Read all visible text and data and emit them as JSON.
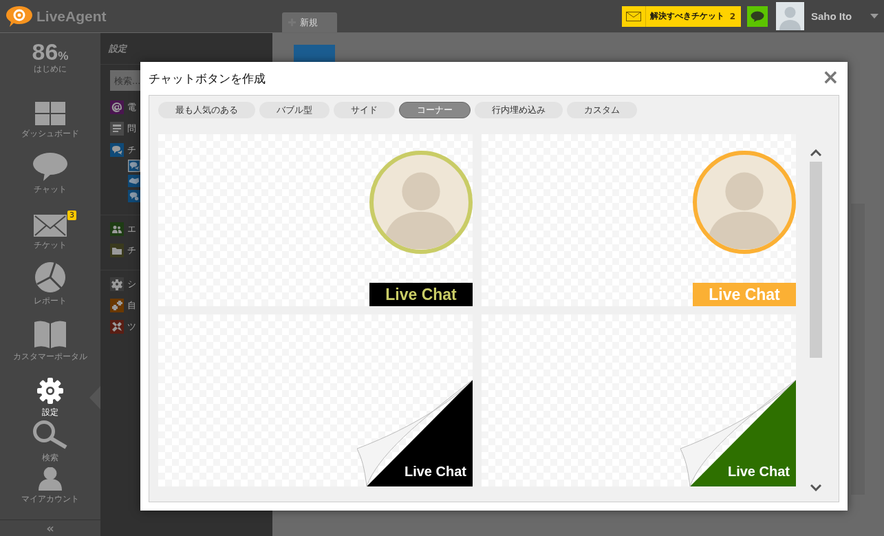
{
  "app": {
    "name": "LiveAgent"
  },
  "new_tab": {
    "label": "新規"
  },
  "ticket_button": {
    "label": "解決すべきチケット",
    "count": "2"
  },
  "user": {
    "name": "Saho Ito"
  },
  "nav": {
    "progress": {
      "value": "86",
      "unit": "%",
      "label": "はじめに"
    },
    "items": [
      {
        "kind": "dashboard",
        "label": "ダッシュボード",
        "selected": false
      },
      {
        "kind": "chat",
        "label": "チャット",
        "selected": false
      },
      {
        "kind": "tickets",
        "label": "チケット",
        "selected": false,
        "badge": "3"
      },
      {
        "kind": "reports",
        "label": "レポート",
        "selected": false
      },
      {
        "kind": "portal",
        "label": "カスタマーポータル",
        "selected": false
      },
      {
        "kind": "settings",
        "label": "設定",
        "selected": true
      },
      {
        "kind": "search",
        "label": "検索",
        "selected": false
      },
      {
        "kind": "account",
        "label": "マイアカウント",
        "selected": false
      }
    ],
    "collapse": "«"
  },
  "settings_panel": {
    "title": "設定",
    "search": {
      "placeholder": "検索..."
    },
    "groups": [
      [
        {
          "kind": "email",
          "label": "電",
          "color": "#4a1650"
        },
        {
          "kind": "form",
          "label": "問",
          "color": "#4a4a4a"
        },
        {
          "kind": "chat",
          "label": "チ",
          "color": "#0f4a78",
          "children": [
            {
              "kind": "chat",
              "selected": true
            },
            {
              "kind": "hand",
              "selected": false
            },
            {
              "kind": "chat-gear",
              "selected": false
            }
          ]
        }
      ],
      [
        {
          "kind": "agents",
          "label": "エ",
          "color": "#1e3c14"
        },
        {
          "kind": "folder",
          "label": "チ",
          "color": "#3a3a1e"
        }
      ],
      [
        {
          "kind": "gear",
          "label": "シ",
          "color": "#3c3c3c"
        },
        {
          "kind": "gears",
          "label": "自",
          "color": "#6a3800"
        },
        {
          "kind": "tools",
          "label": "ツ",
          "color": "#5a1e14"
        }
      ]
    ]
  },
  "modal": {
    "title": "チャットボタンを作成",
    "close": "×",
    "tabs": [
      {
        "label": "最も人気のある",
        "selected": false
      },
      {
        "label": "バブル型",
        "selected": false
      },
      {
        "label": "サイド",
        "selected": false
      },
      {
        "label": "コーナー",
        "selected": true
      },
      {
        "label": "行内埋め込み",
        "selected": false
      },
      {
        "label": "カスタム",
        "selected": false
      }
    ],
    "previews": [
      {
        "kind": "circle-dark",
        "label": "Live Chat",
        "color": "#c9cc66"
      },
      {
        "kind": "circle-filled",
        "label": "Live Chat",
        "color": "#fbb034"
      },
      {
        "kind": "corner",
        "label": "Live Chat",
        "color": "#000000"
      },
      {
        "kind": "corner",
        "label": "Live Chat",
        "color": "#2e7000"
      }
    ]
  }
}
